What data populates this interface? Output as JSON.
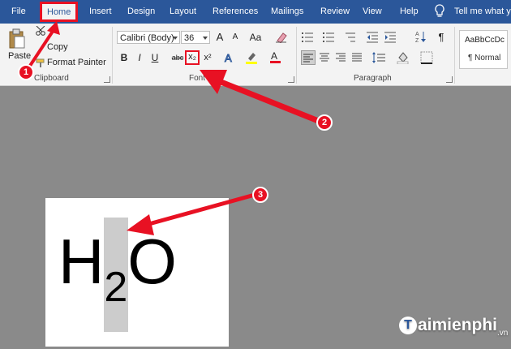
{
  "tabs": [
    "File",
    "Home",
    "Insert",
    "Design",
    "Layout",
    "References",
    "Mailings",
    "Review",
    "View",
    "Help"
  ],
  "tell_me": "Tell me what yo",
  "clipboard": {
    "paste": "Paste",
    "copy": "Copy",
    "format_painter": "Format Painter",
    "label": "Clipboard"
  },
  "font": {
    "name": "Calibri (Body)",
    "size": "36",
    "label": "Font",
    "bold": "B",
    "italic": "I",
    "underline": "U",
    "strikethrough": "abc",
    "subscript": "x₂",
    "superscript": "x²",
    "grow": "A",
    "change_case": "Aa"
  },
  "paragraph": {
    "label": "Paragraph",
    "pilcrow": "¶"
  },
  "styles": {
    "preview": "AaBbCcDc",
    "name": "¶ Normal"
  },
  "example": {
    "base1": "H",
    "sub": "2",
    "base2": "O"
  },
  "callouts": [
    "1",
    "2",
    "3"
  ],
  "watermark": {
    "brand": "aimienphi",
    "tld": ".vn"
  },
  "colors": {
    "ribbon_blue": "#2b579a",
    "annotation_red": "#e81123"
  }
}
